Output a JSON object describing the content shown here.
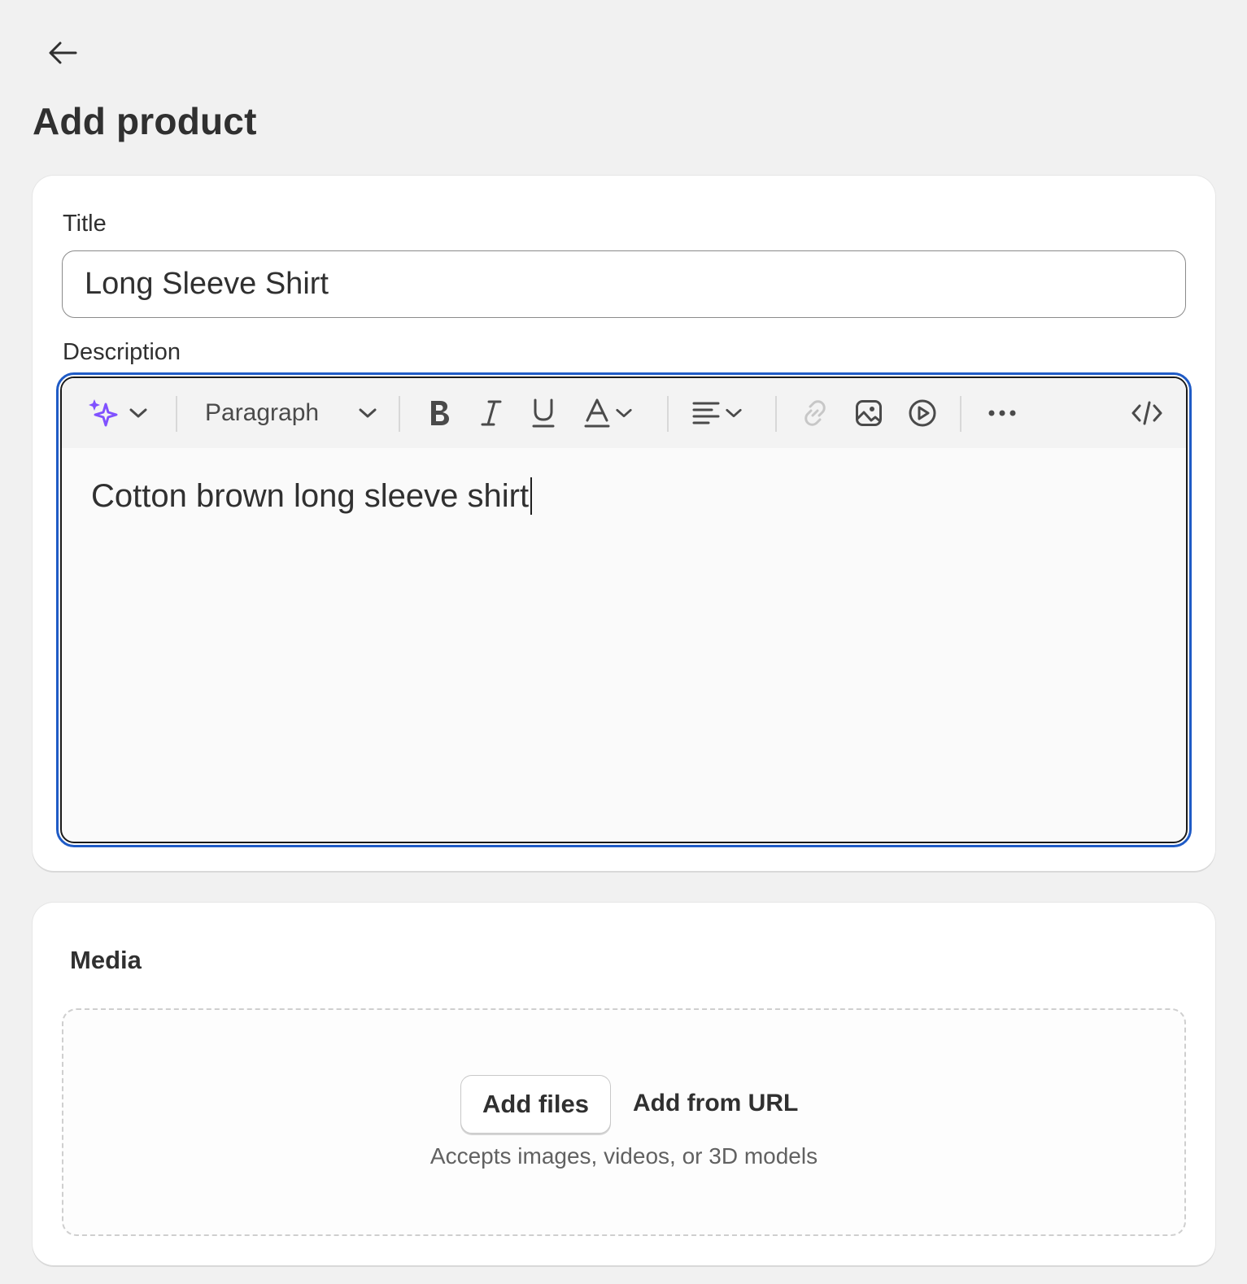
{
  "header": {
    "back_icon": "arrow-left-icon",
    "title": "Add product"
  },
  "product": {
    "title_label": "Title",
    "title_value": "Long Sleeve Shirt",
    "description_label": "Description",
    "description_value": "Cotton brown long sleeve shirt"
  },
  "editor_toolbar": {
    "ai_icon": "sparkles-icon",
    "format_select": "Paragraph",
    "icons": [
      "bold-icon",
      "italic-icon",
      "underline-icon",
      "text-color-icon",
      "align-icon",
      "link-icon",
      "image-icon",
      "video-icon",
      "more-icon",
      "code-icon"
    ]
  },
  "media": {
    "title": "Media",
    "add_files_label": "Add files",
    "add_from_url_label": "Add from URL",
    "accepts_text": "Accepts images, videos, or 3D models"
  },
  "colors": {
    "focus_ring": "#1f5bc6",
    "ai_accent": "#8051ff",
    "background": "#f1f1f1"
  }
}
